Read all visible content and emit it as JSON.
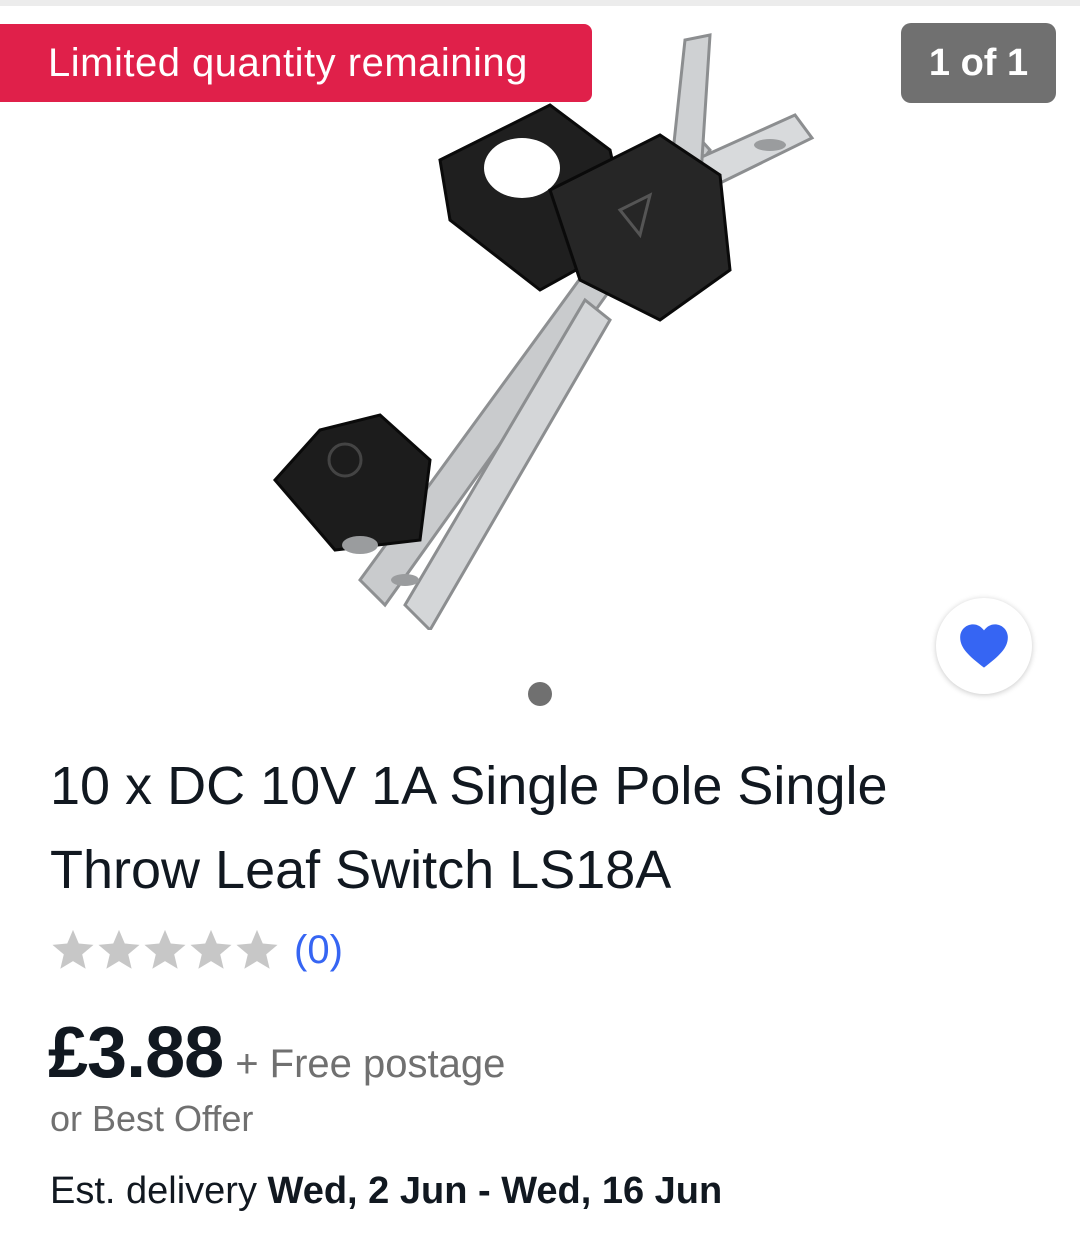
{
  "gallery": {
    "badge": "Limited quantity remaining",
    "counter": "1 of 1",
    "watch_icon": "heart-icon",
    "pagination": {
      "current": 1,
      "total": 1
    }
  },
  "listing": {
    "title_line1": "10 x DC 10V 1A Single Pole Single",
    "title_line2": "Throw Leaf Switch LS18A",
    "rating": {
      "stars": 0,
      "max": 5,
      "count_label": "(0)"
    },
    "price": "£3.88",
    "postage": "+ Free postage",
    "offer": "or Best Offer",
    "delivery_label": "Est. delivery",
    "delivery_dates": "Wed, 2 Jun - Wed, 16 Jun"
  },
  "colors": {
    "badge": "#e0204a",
    "counter": "#707070",
    "link": "#3665f3",
    "heart": "#3665f3",
    "muted_text": "#707070",
    "star_empty": "#c7c7c7"
  }
}
